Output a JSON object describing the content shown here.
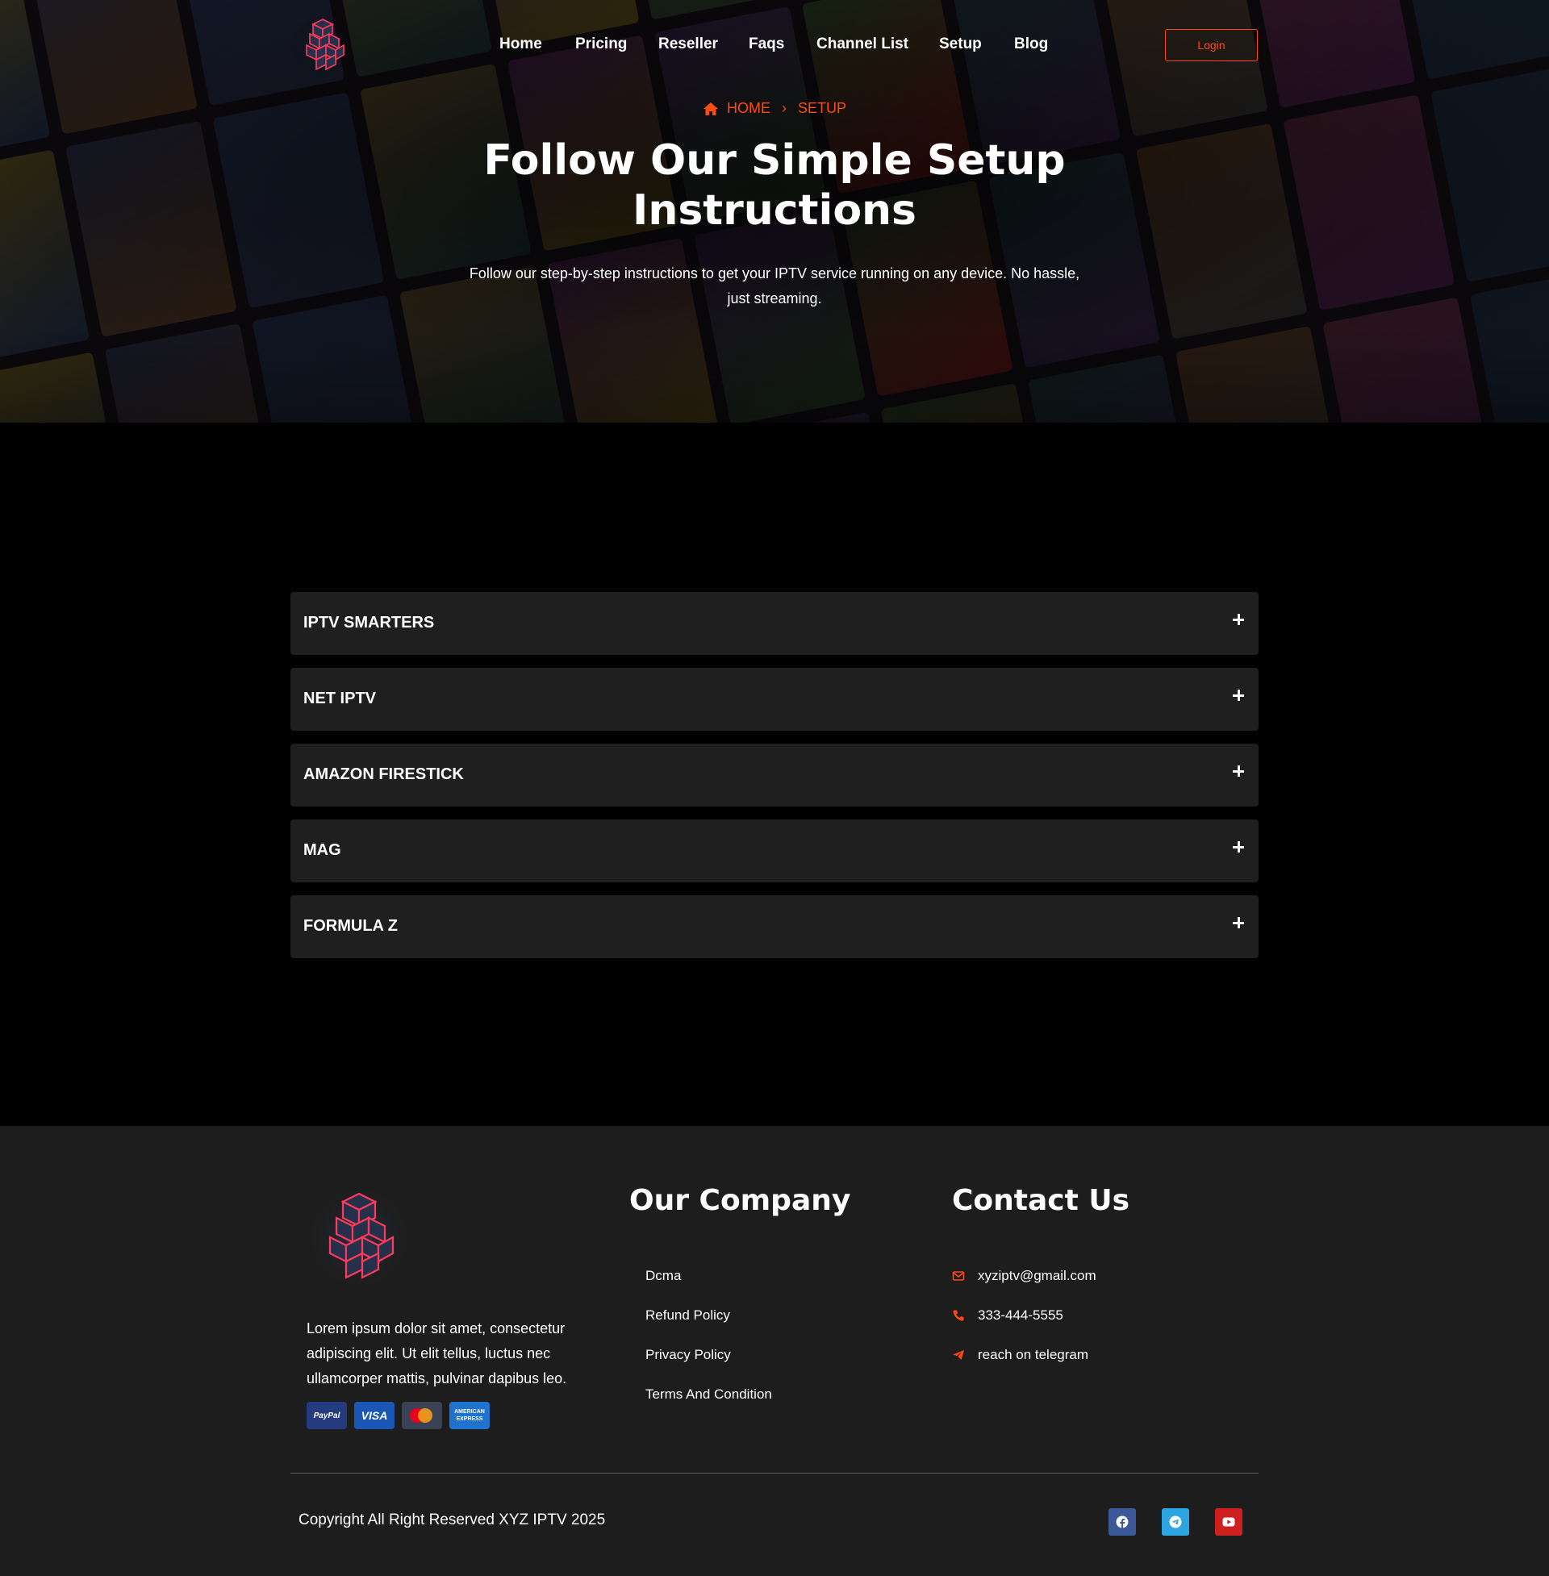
{
  "brand": {
    "accent": "#ff4a12",
    "logo_icon": "cube-logo-icon"
  },
  "nav": {
    "items": [
      "Home",
      "Pricing",
      "Reseller",
      "Faqs",
      "Channel List",
      "Setup",
      "Blog"
    ],
    "login_label": "Login"
  },
  "breadcrumb": {
    "home": "HOME",
    "current": "SETUP"
  },
  "hero": {
    "title": "Follow Our Simple Setup Instructions",
    "subtitle": "Follow our step-by-step instructions to get your IPTV service running on any device. No hassle, just streaming."
  },
  "accordion": {
    "items": [
      "IPTV SMARTERS",
      "NET IPTV",
      "AMAZON FIRESTICK",
      "MAG",
      "FORMULA Z"
    ]
  },
  "footer": {
    "about": "Lorem ipsum dolor sit amet, consectetur adipiscing elit. Ut elit tellus, luctus nec ullamcorper mattis, pulvinar dapibus leo.",
    "payments": {
      "paypal": "PayPal",
      "visa": "VISA",
      "mastercard_icon": "mastercard-icon",
      "amex": "AMERICAN EXPRESS"
    },
    "company_heading": "Our Company",
    "company_links": [
      "Dcma",
      "Refund Policy",
      "Privacy Policy",
      "Terms And Condition"
    ],
    "contact_heading": "Contact Us",
    "contact": {
      "email": "xyziptv@gmail.com",
      "phone": "333-444-5555",
      "telegram": "reach on telegram"
    },
    "copyright": "Copyright All Right Reserved XYZ IPTV 2025",
    "socials": [
      "facebook-icon",
      "telegram-icon",
      "youtube-icon"
    ]
  }
}
